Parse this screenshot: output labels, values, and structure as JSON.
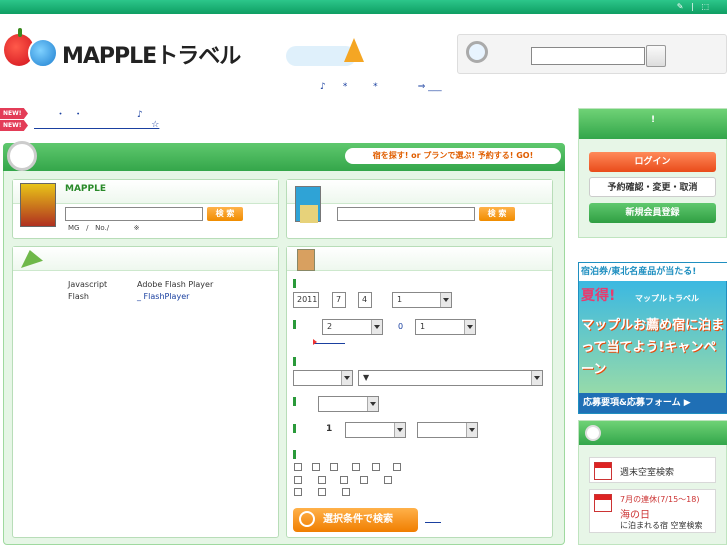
{
  "topbar": {
    "text": "✎   |   ⬚"
  },
  "logo": {
    "text": "MAPPLEトラベル"
  },
  "notice": {
    "text": "♪      *         *              ⇒ ___"
  },
  "news": {
    "badge": "NEW!",
    "line1": "       ・   ・                   ♪",
    "line2": "                                         ☆"
  },
  "header": {
    "go_text": "宿を探す! or プランで選ぶ! 予約する! GO!"
  },
  "mapple_panel": {
    "title": "MAPPLE",
    "search_label": "検 索",
    "sub": "MG   /   No./           ※"
  },
  "hotel_panel": {
    "search_label": "検 索"
  },
  "flash_panel": {
    "line1_a": "Javascript",
    "line1_b": "Adobe Flash Player",
    "line2_a": "Flash",
    "line2_b": "_ FlashPlayer"
  },
  "form": {
    "year": "2011",
    "month": "7",
    "day": "4",
    "nights": "1",
    "rooms": "2",
    "adults_sep": "0",
    "adults": "1",
    "count_label": "1",
    "submit": "選択条件で検索"
  },
  "side": {
    "top_label": "!",
    "login": "ログイン",
    "confirm": "予約確認・変更・取消",
    "register": "新規会員登録"
  },
  "ad": {
    "top": "宿泊券/東北名産品が当たる!",
    "title": "夏得!",
    "sub": "マップルトラベル",
    "body": "マップルお薦め宿に泊まって当てよう!キャンペーン",
    "footer": "応募要項&応募フォーム ▶"
  },
  "side2": {
    "item1": "週末空室検索",
    "item2_line1": "7月の連休(7/15〜18)",
    "item2_line2": "海の日",
    "item2_line3": "に泊まれる宿 空室検索"
  }
}
